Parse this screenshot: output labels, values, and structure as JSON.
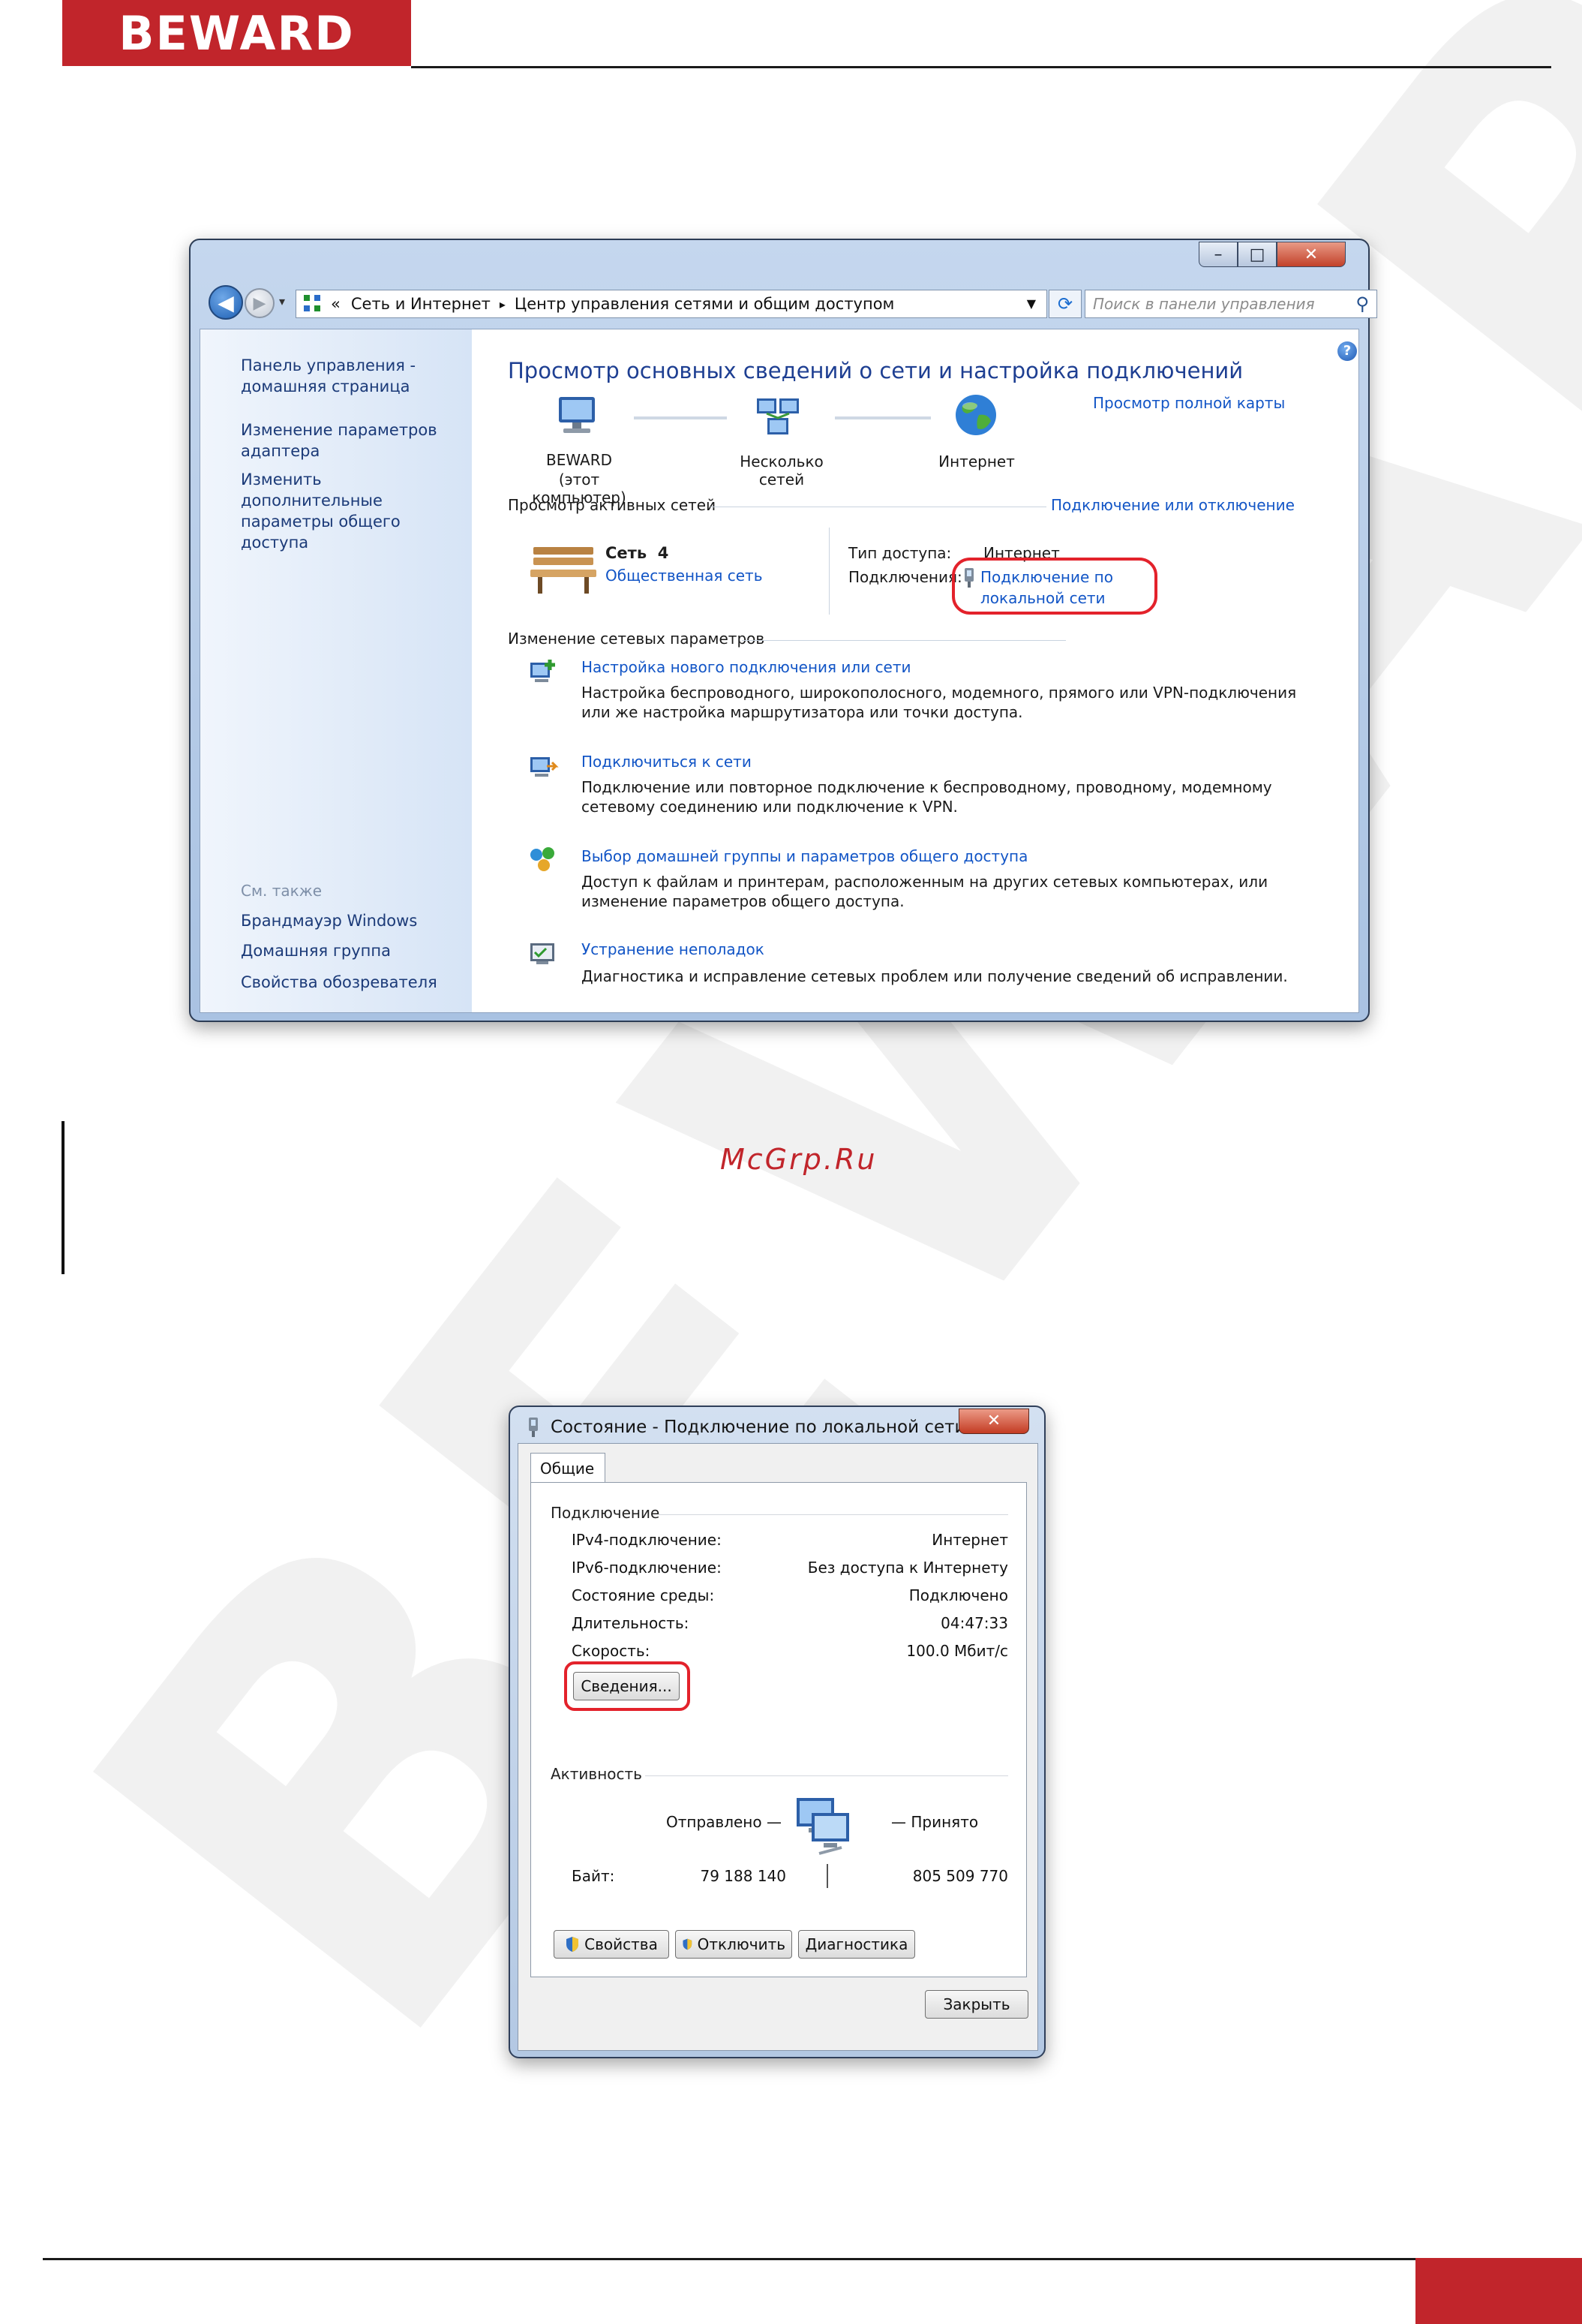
{
  "page": {
    "logo": "BEWARD",
    "watermark": "BEWARD",
    "credit": "McGrp.Ru"
  },
  "network_center": {
    "caption_buttons": {
      "minimize": "–",
      "maximize": "□",
      "close": "✕"
    },
    "breadcrumb": {
      "prefix": "«",
      "items": [
        "Сеть и Интернет",
        "Центр управления сетями и общим доступом"
      ],
      "separator": "▸"
    },
    "search_placeholder": "Поиск в панели управления",
    "sidebar": {
      "links": [
        "Панель управления - домашняя страница",
        "Изменение параметров адаптера",
        "Изменить дополнительные параметры общего доступа"
      ],
      "see_also_heading": "См. также",
      "see_also": [
        "Брандмауэр Windows",
        "Домашняя группа",
        "Свойства обозревателя"
      ]
    },
    "title": "Просмотр основных сведений о сети и настройка подключений",
    "full_map_link": "Просмотр полной карты",
    "map": [
      {
        "label": "BEWARD",
        "sublabel": "(этот компьютер)",
        "icon": "computer-icon"
      },
      {
        "label": "Несколько сетей",
        "sublabel": "",
        "icon": "multiple-networks-icon"
      },
      {
        "label": "Интернет",
        "sublabel": "",
        "icon": "globe-icon"
      }
    ],
    "active_networks_heading": "Просмотр активных сетей",
    "connect_disconnect_link": "Подключение или отключение",
    "network": {
      "name": "Сеть  4",
      "type": "Общественная сеть",
      "access_type_label": "Тип доступа:",
      "access_type_value": "Интернет",
      "connections_label": "Подключения:",
      "connection_link_line1": "Подключение по",
      "connection_link_line2": "локальной сети"
    },
    "change_settings_heading": "Изменение сетевых параметров",
    "tasks": [
      {
        "link": "Настройка нового подключения или сети",
        "line1": "Настройка беспроводного, широкополосного, модемного, прямого или VPN-подключения",
        "line2": "или же настройка маршрутизатора или точки доступа."
      },
      {
        "link": "Подключиться к сети",
        "line1": "Подключение или повторное подключение к беспроводному, проводному, модемному",
        "line2": "сетевому соединению или подключение к VPN."
      },
      {
        "link": "Выбор домашней группы и параметров общего доступа",
        "line1": "Доступ к файлам и принтерам, расположенным на других сетевых компьютерах, или",
        "line2": "изменение параметров общего доступа."
      },
      {
        "link": "Устранение неполадок",
        "line1": "Диагностика и исправление сетевых проблем или получение сведений об исправлении.",
        "line2": ""
      }
    ]
  },
  "status_dialog": {
    "title": "Состояние - Подключение по локальной сети",
    "close": "✕",
    "tab": "Общие",
    "connection_group": "Подключение",
    "rows": [
      {
        "key": "IPv4-подключение:",
        "value": "Интернет"
      },
      {
        "key": "IPv6-подключение:",
        "value": "Без доступа к Интернету"
      },
      {
        "key": "Состояние среды:",
        "value": "Подключено"
      },
      {
        "key": "Длительность:",
        "value": "04:47:33"
      },
      {
        "key": "Скорость:",
        "value": "100.0 Мбит/с"
      }
    ],
    "details_button": "Сведения...",
    "activity_group": "Активность",
    "sent_label": "Отправлено —",
    "received_label": "— Принято",
    "bytes_label": "Байт:",
    "bytes_sent": "79 188 140",
    "bytes_received": "805 509 770",
    "buttons": [
      "Свойства",
      "Отключить",
      "Диагностика"
    ],
    "close_button": "Закрыть"
  }
}
